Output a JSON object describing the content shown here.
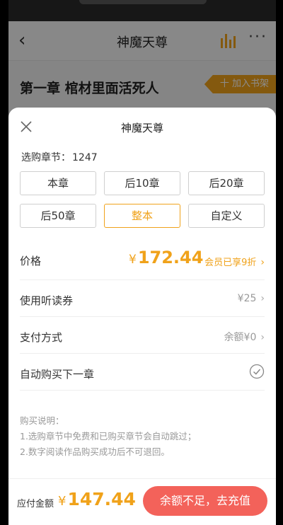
{
  "nav": {
    "back_glyph": "‹",
    "title": "神魔天尊",
    "more_glyph": "···"
  },
  "chapter": {
    "title": "第一章 棺材里面活死人",
    "shelf_label": "十 加入书架"
  },
  "sheet": {
    "title": "神魔天尊",
    "select_label": "选购章节：",
    "select_count": "1247",
    "options": [
      {
        "label": "本章"
      },
      {
        "label": "后10章"
      },
      {
        "label": "后20章"
      },
      {
        "label": "后50章"
      },
      {
        "label": "整本",
        "active": true
      },
      {
        "label": "自定义"
      }
    ],
    "price": {
      "label": "价格",
      "currency": "¥",
      "amount": "172.44",
      "vip_text": "会员已享9折"
    },
    "voucher": {
      "label": "使用听读券",
      "value": "¥25"
    },
    "payment": {
      "label": "支付方式",
      "value": "余额¥0"
    },
    "auto_buy": {
      "label": "自动购买下一章",
      "checked": true
    },
    "notes": {
      "heading": "购买说明：",
      "line1": "1.选购章节中免费和已购买章节会自动跳过；",
      "line2": "2.数字阅读作品购买成功后不可退回。"
    }
  },
  "footer": {
    "due_label": "应付金额",
    "currency": "¥",
    "due_amount": "147.44",
    "pay_button": "余额不足，去充值"
  },
  "colors": {
    "accent": "#f0a21a",
    "button": "#f3625a"
  }
}
